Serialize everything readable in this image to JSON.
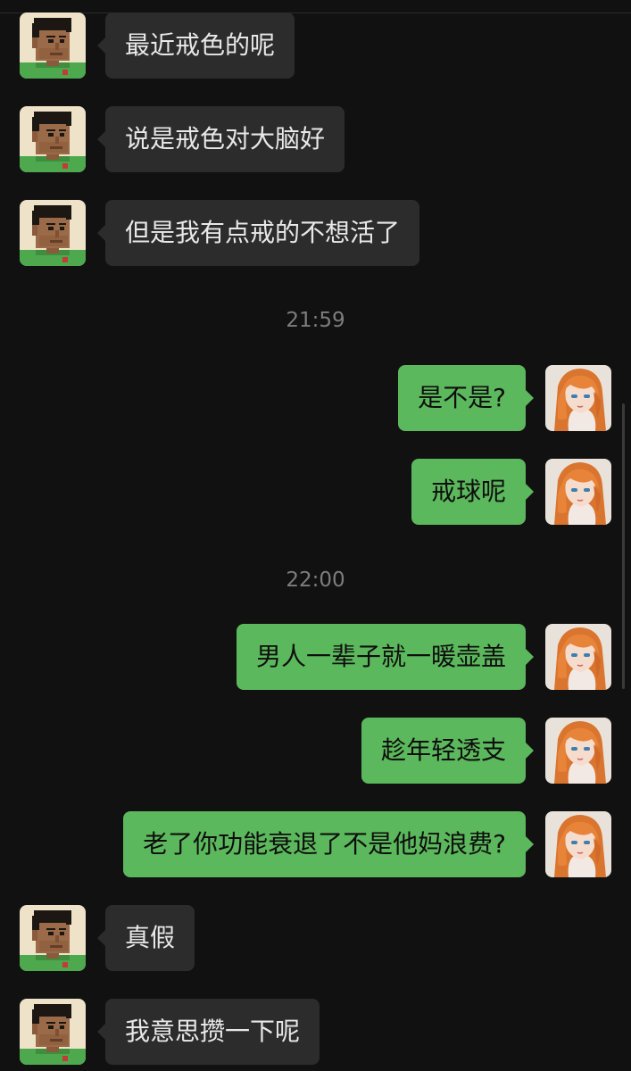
{
  "chat": {
    "messages": [
      {
        "sender": "friend",
        "text": "最近戒色的呢"
      },
      {
        "sender": "friend",
        "text": "说是戒色对大脑好"
      },
      {
        "sender": "friend",
        "text": "但是我有点戒的不想活了"
      },
      {
        "type": "time",
        "text": "21:59"
      },
      {
        "sender": "me",
        "text": "是不是?"
      },
      {
        "sender": "me",
        "text": "戒球呢"
      },
      {
        "type": "time",
        "text": "22:00"
      },
      {
        "sender": "me",
        "text": "男人一辈子就一暖壶盖"
      },
      {
        "sender": "me",
        "text": "趁年轻透支"
      },
      {
        "sender": "me",
        "text": "老了你功能衰退了不是他妈浪费?"
      },
      {
        "sender": "friend",
        "text": "真假"
      },
      {
        "sender": "friend",
        "text": "我意思攒一下呢"
      }
    ]
  },
  "avatars": {
    "friend": "pixel-art-man-avatar",
    "me": "anime-girl-avatar"
  },
  "colors": {
    "background": "#111111",
    "incoming_bubble": "#2c2c2c",
    "outgoing_bubble": "#5cb85c",
    "timestamp": "#7d7d7d"
  }
}
